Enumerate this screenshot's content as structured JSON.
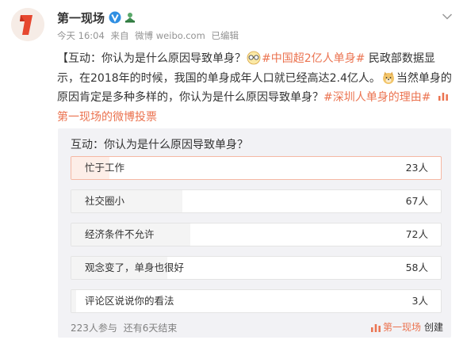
{
  "account": {
    "name": "第一现场",
    "time": "今天 16:04",
    "source_prefix": "来自",
    "source": "微博 weibo.com",
    "edited": "已编辑"
  },
  "post": {
    "intro": "【互动：你认为是什么原因导致单身？",
    "hashtag_1": "#中国超2亿人单身#",
    "text_1": " 民政部数据显示，在2018年的时候，我国的单身成年人口就已经高达2.4亿人。",
    "text_2": "当然单身的原因肯定是多种多样的，你认为是什么原因导致单身？",
    "hashtag_2": "#深圳人单身的理由#",
    "link_text": "第一现场的微博投票"
  },
  "vote": {
    "title": "互动：你认为是什么原因导致单身？",
    "total_votes": 223,
    "options": [
      {
        "label": "忙于工作",
        "count_text": "23人",
        "votes": 23,
        "selected": true
      },
      {
        "label": "社交圈小",
        "count_text": "67人",
        "votes": 67,
        "selected": false
      },
      {
        "label": "经济条件不允许",
        "count_text": "72人",
        "votes": 72,
        "selected": false
      },
      {
        "label": "观念变了，单身也很好",
        "count_text": "58人",
        "votes": 58,
        "selected": false
      },
      {
        "label": "评论区说说你的看法",
        "count_text": "3人",
        "votes": 3,
        "selected": false
      }
    ],
    "participants": "223人参与",
    "time_left": "还有6天结束",
    "creator": "第一现场",
    "created_label": "创建"
  },
  "colors": {
    "accent": "#eb7350",
    "card_bg": "#f2f2f5",
    "bar_fill": "#f4f4f4",
    "bar_fill_selected": "#fdeee8"
  },
  "icons": [
    "avatar-logo",
    "verified-icon",
    "member-icon",
    "chevron-down-icon",
    "glasses-emoji",
    "doge-emoji",
    "vote-icon"
  ]
}
